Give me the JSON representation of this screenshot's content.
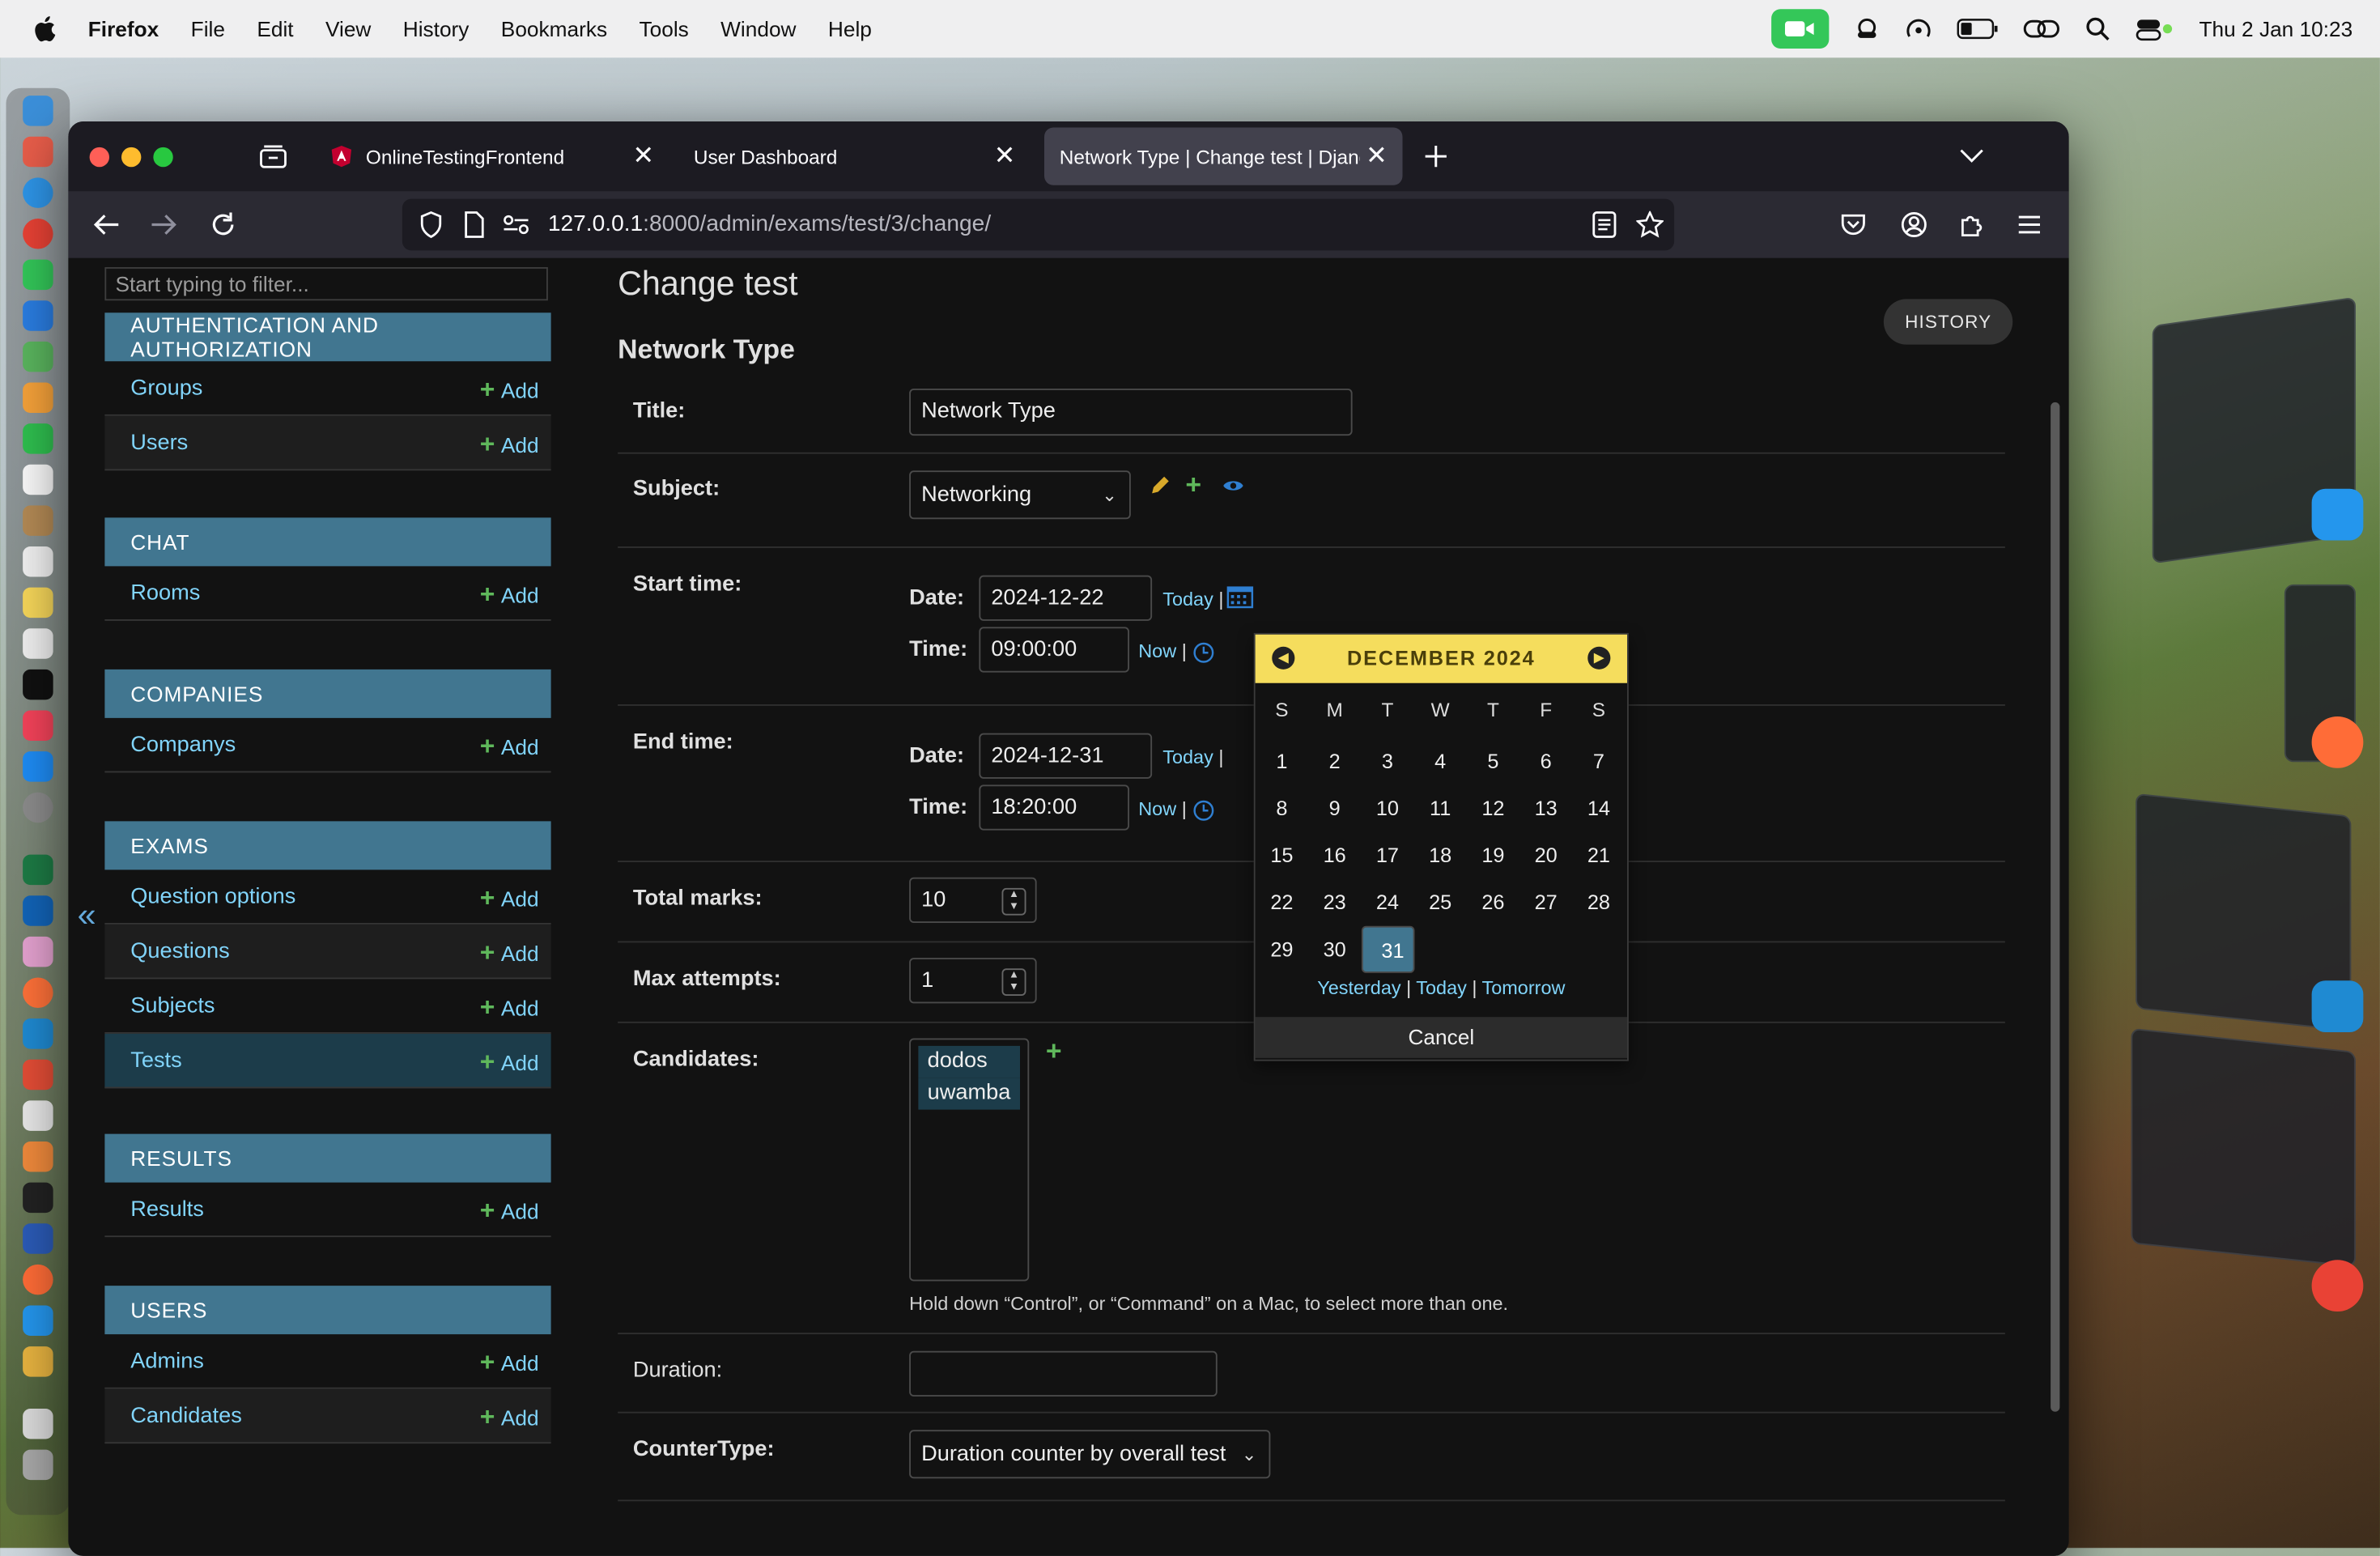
{
  "menubar": {
    "app": "Firefox",
    "items": [
      "File",
      "Edit",
      "View",
      "History",
      "Bookmarks",
      "Tools",
      "Window",
      "Help"
    ],
    "datetime": "Thu 2 Jan  10:23"
  },
  "tabs": [
    {
      "title": "OnlineTestingFrontend"
    },
    {
      "title": "User Dashboard"
    },
    {
      "title": "Network Type | Change test | Djang"
    }
  ],
  "url": {
    "host": "127.0.0.1",
    "rest": ":8000/admin/exams/test/3/change/"
  },
  "sidebar": {
    "filter_placeholder": "Start typing to filter...",
    "collapse": "«",
    "add_label": "Add",
    "modules": [
      {
        "name": "AUTHENTICATION AND AUTHORIZATION",
        "items": [
          "Groups",
          "Users"
        ]
      },
      {
        "name": "CHAT",
        "items": [
          "Rooms"
        ]
      },
      {
        "name": "COMPANIES",
        "items": [
          "Companys"
        ]
      },
      {
        "name": "EXAMS",
        "items": [
          "Question options",
          "Questions",
          "Subjects",
          "Tests"
        ]
      },
      {
        "name": "RESULTS",
        "items": [
          "Results"
        ]
      },
      {
        "name": "USERS",
        "items": [
          "Admins",
          "Candidates"
        ]
      }
    ]
  },
  "main": {
    "heading": "Change test",
    "object_title": "Network Type",
    "history_button": "HISTORY",
    "fields": {
      "title_label": "Title:",
      "title_value": "Network Type",
      "subject_label": "Subject:",
      "subject_value": "Networking",
      "start_label": "Start time:",
      "end_label": "End time:",
      "date_label": "Date:",
      "time_label": "Time:",
      "start_date": "2024-12-22",
      "start_time": "09:00:00",
      "end_date": "2024-12-31",
      "end_time": "18:20:00",
      "today_link": "Today",
      "now_link": "Now",
      "sep": "|",
      "total_marks_label": "Total marks:",
      "total_marks_value": "10",
      "max_attempts_label": "Max attempts:",
      "max_attempts_value": "1",
      "candidates_label": "Candidates:",
      "candidates_options": [
        "dodos",
        "uwamba"
      ],
      "candidates_help": "Hold down “Control”, or “Command” on a Mac, to select more than one.",
      "duration_label": "Duration:",
      "duration_value": "",
      "counter_label": "CounterType:",
      "counter_value": "Duration counter by overall test"
    }
  },
  "calendar": {
    "month_label": "DECEMBER 2024",
    "weekdays": [
      "S",
      "M",
      "T",
      "W",
      "T",
      "F",
      "S"
    ],
    "first_weekday": 0,
    "days_in_month": 31,
    "selected_day": 31,
    "links": {
      "yesterday": "Yesterday",
      "today": "Today",
      "tomorrow": "Tomorrow"
    },
    "cancel": "Cancel"
  },
  "colors": {
    "module_header": "#417690",
    "calendar_header": "#f5dd5d",
    "link": "#81d4fa",
    "add_plus": "#5fb85b"
  }
}
